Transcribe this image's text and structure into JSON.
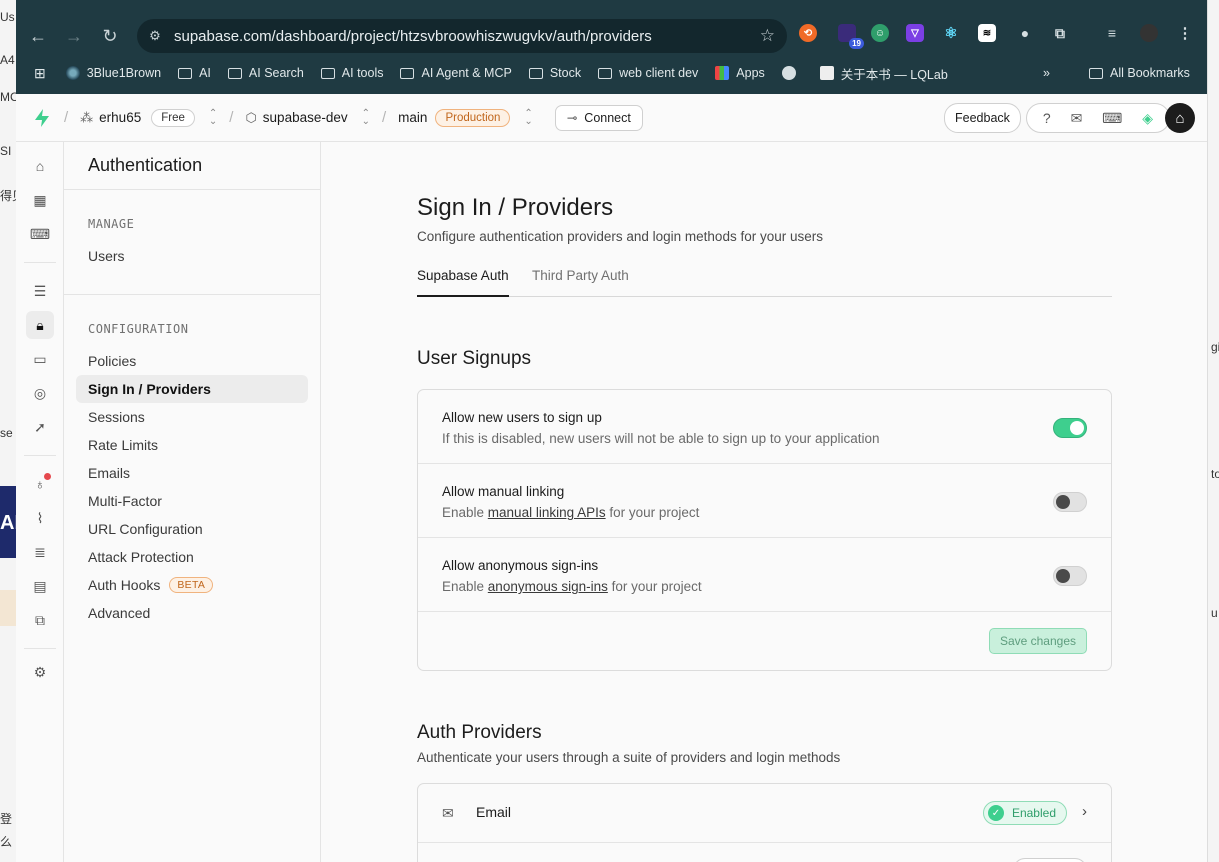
{
  "bg_left_fragments": [
    "Us",
    "A4",
    "MC",
    "SI",
    "得见",
    "se",
    "AI",
    "登",
    "么"
  ],
  "bg_right_fragments": [
    "gi",
    "to",
    "u"
  ],
  "browser": {
    "url": "supabase.com/dashboard/project/htzsvbroowhiszwugvkv/auth/providers",
    "ext_badge": "19",
    "bookmarks": [
      {
        "label": "3Blue1Brown",
        "icon": "globe-icon"
      },
      {
        "label": "AI",
        "icon": "folder-icon"
      },
      {
        "label": "AI Search",
        "icon": "folder-icon"
      },
      {
        "label": "AI tools",
        "icon": "folder-icon"
      },
      {
        "label": "AI Agent & MCP",
        "icon": "folder-icon"
      },
      {
        "label": "Stock",
        "icon": "folder-icon"
      },
      {
        "label": "web client dev",
        "icon": "folder-icon"
      },
      {
        "label": "Apps",
        "icon": "grid-icon"
      },
      {
        "label": "",
        "icon": "globe-icon"
      },
      {
        "label": "关于本书 — LQLab",
        "icon": "site-icon"
      }
    ],
    "all_bookmarks": "All Bookmarks",
    "overflow": "»"
  },
  "topbar": {
    "org": "erhu65",
    "org_plan": "Free",
    "project": "supabase-dev",
    "branch": "main",
    "branch_env": "Production",
    "connect": "Connect",
    "feedback": "Feedback",
    "accent": "#3ecf8e"
  },
  "subnav": {
    "title": "Authentication",
    "manage_label": "MANAGE",
    "users": "Users",
    "config_label": "CONFIGURATION",
    "items": [
      "Policies",
      "Sign In / Providers",
      "Sessions",
      "Rate Limits",
      "Emails",
      "Multi-Factor",
      "URL Configuration",
      "Attack Protection",
      "Auth Hooks",
      "Advanced"
    ],
    "beta": "BETA"
  },
  "main": {
    "title": "Sign In / Providers",
    "subtitle": "Configure authentication providers and login methods for your users",
    "tabs": [
      "Supabase Auth",
      "Third Party Auth"
    ],
    "signups": {
      "heading": "User Signups",
      "rows": [
        {
          "title": "Allow new users to sign up",
          "desc_pre": "If this is disabled, new users will not be able to sign up to your application",
          "link": "",
          "desc_post": "",
          "enabled": true
        },
        {
          "title": "Allow manual linking",
          "desc_pre": "Enable ",
          "link": "manual linking APIs",
          "desc_post": " for your project",
          "enabled": false
        },
        {
          "title": "Allow anonymous sign-ins",
          "desc_pre": "Enable ",
          "link": "anonymous sign-ins",
          "desc_post": " for your project",
          "enabled": false
        }
      ],
      "save": "Save changes"
    },
    "providers": {
      "heading": "Auth Providers",
      "subtitle": "Authenticate your users through a suite of providers and login methods",
      "email": "Email",
      "email_status": "Enabled"
    }
  }
}
